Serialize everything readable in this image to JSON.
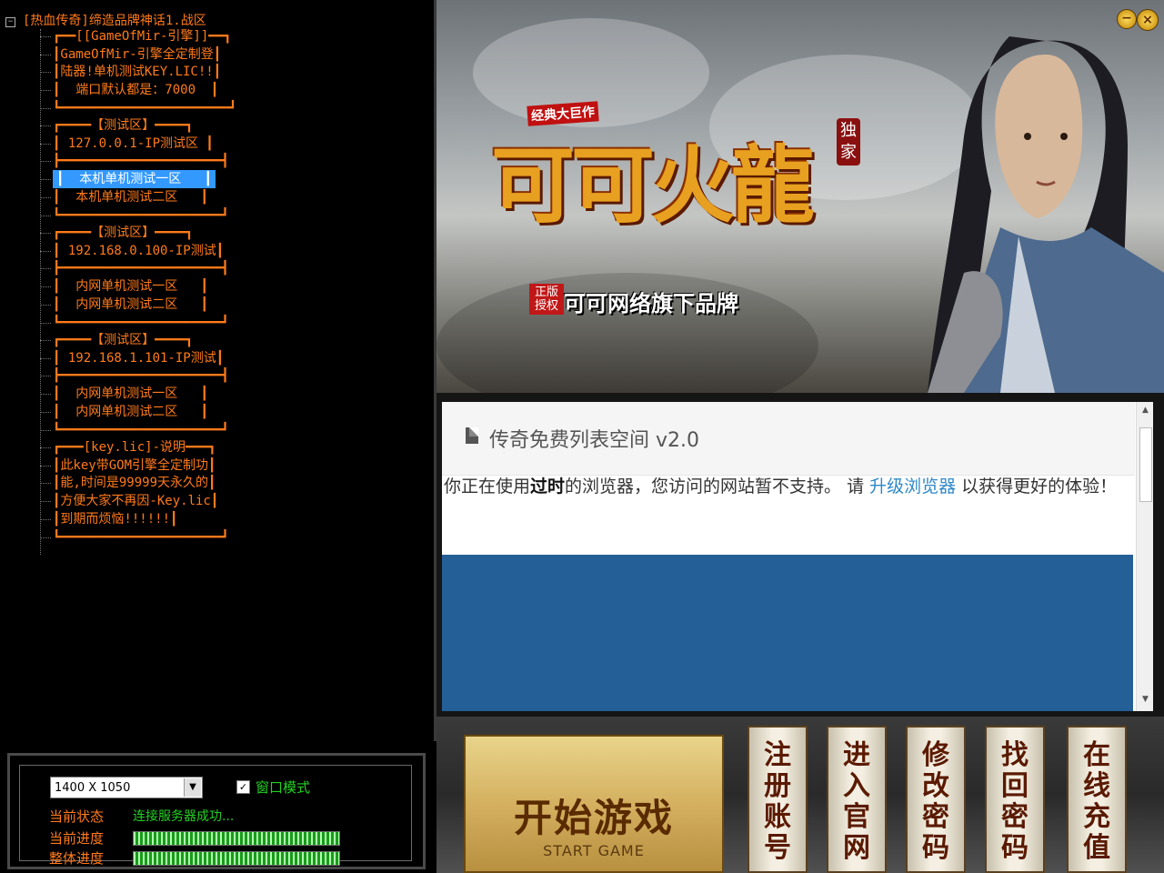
{
  "tree": {
    "root_label": "[热血传奇]缔造品牌神话1.战区",
    "nodes": [
      "┏━━[[GameOfMir-引擎]]━━┓",
      "┃GameOfMir-引擎全定制登┃",
      "┃陆器!单机测试KEY.LIC!!┃",
      "┃  端口默认都是：7000  ┃",
      "┗━━━━━━━━━━━━━━━━━━━━━━┛",
      "┏━━━━【测试区】━━━━┓",
      "┃ 127.0.0.1-IP测试区 ┃",
      "┣━━━━━━━━━━━━━━━━━━━━━┫",
      "┃  本机单机测试一区   ┃",
      "┃  本机单机测试二区   ┃",
      "┗━━━━━━━━━━━━━━━━━━━━━┛",
      "┏━━━━【测试区】━━━━┓",
      "┃ 192.168.0.100-IP测试┃",
      "┣━━━━━━━━━━━━━━━━━━━━━┫",
      "┃  内网单机测试一区   ┃",
      "┃  内网单机测试二区   ┃",
      "┗━━━━━━━━━━━━━━━━━━━━━┛",
      "┏━━━━【测试区】━━━━┓",
      "┃ 192.168.1.101-IP测试┃",
      "┣━━━━━━━━━━━━━━━━━━━━━┫",
      "┃  内网单机测试一区   ┃",
      "┃  内网单机测试二区   ┃",
      "┗━━━━━━━━━━━━━━━━━━━━━┛",
      "┏━━━[key.lic]-说明━━━┓",
      "┃此key带GOM引擎全定制功┃",
      "┃能,时间是99999天永久的┃",
      "┃方便大家不再因-Key.lic┃",
      "┃到期而烦恼!!!!!!┃",
      "┗━━━━━━━━━━━━━━━━━━━━━┛"
    ],
    "selected_index": 8
  },
  "settings": {
    "resolution": "1400 X 1050",
    "window_mode_label": "窗口模式",
    "window_mode_checked": "✓",
    "status_label": "当前状态",
    "status_value": "连接服务器成功...",
    "current_progress_label": "当前进度",
    "current_progress": 1.0,
    "overall_progress_label": "整体进度",
    "overall_progress": 1.0
  },
  "banner": {
    "tag": "经典大巨作",
    "logo_title": "可可火龍",
    "exclusive": "独家",
    "auth_badge": "正版授权",
    "subbrand": "可可网络旗下品牌",
    "minimize": "−",
    "close": "×"
  },
  "browser": {
    "title": "传奇免费列表空间 v2.0",
    "message_prefix": "你正在使用",
    "message_bold": "过时",
    "message_mid": "的浏览器，您访问的网站暂不支持。 请 ",
    "message_link": "升级浏览器",
    "message_suffix": " 以获得更好的体验！"
  },
  "buttons": {
    "start_cn": "开始游戏",
    "start_en": "START GAME",
    "register": "注册账号",
    "official_site": "进入官网",
    "change_password": "修改密码",
    "recover_password": "找回密码",
    "recharge": "在线充值"
  }
}
